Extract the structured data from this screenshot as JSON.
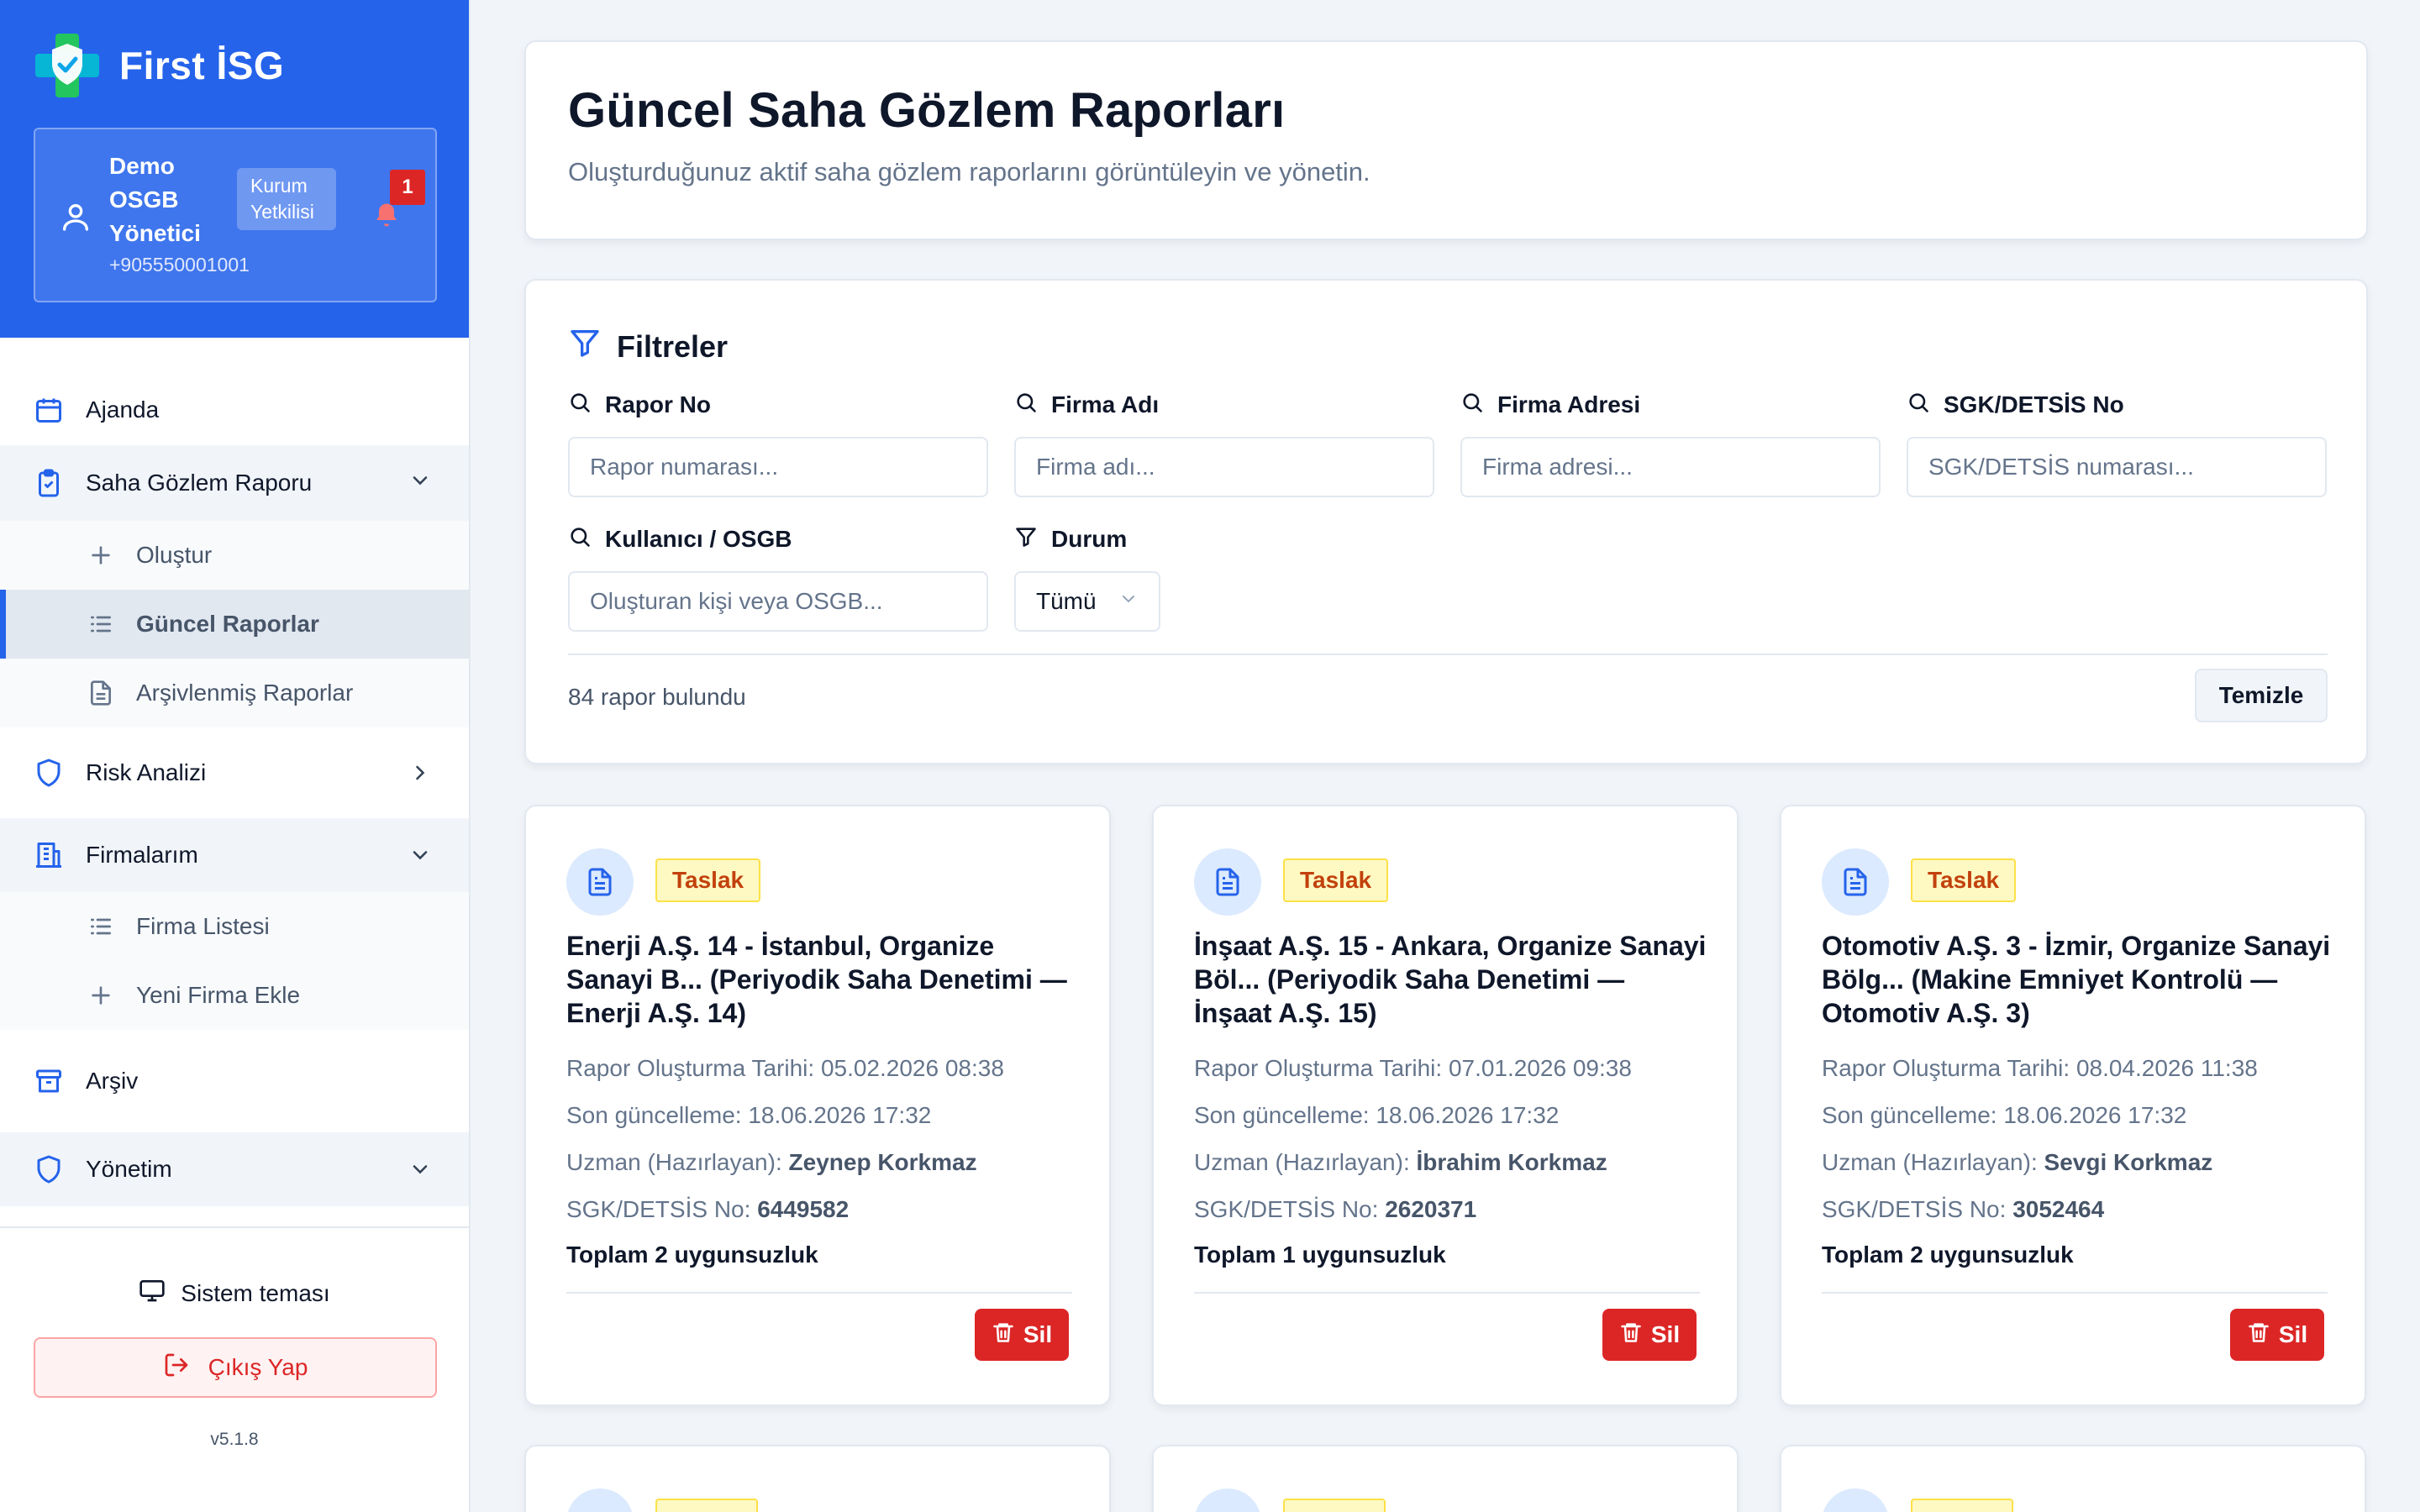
{
  "brand": {
    "name": "First İSG"
  },
  "user": {
    "name": "Demo OSGB Yönetici",
    "phone": "+905550001001",
    "role_line1": "Kurum",
    "role_line2": "Yetkilisi",
    "notifications": "1"
  },
  "nav": {
    "ajanda": "Ajanda",
    "saha": "Saha Gözlem Raporu",
    "saha_sub": [
      "Oluştur",
      "Güncel Raporlar",
      "Arşivlenmiş Raporlar"
    ],
    "risk": "Risk Analizi",
    "firmalarim": "Firmalarım",
    "firma_sub": [
      "Firma Listesi",
      "Yeni Firma Ekle"
    ],
    "arsiv": "Arşiv",
    "yonetim": "Yönetim"
  },
  "sidebar_bottom": {
    "theme": "Sistem teması",
    "logout": "Çıkış Yap",
    "version": "v5.1.8"
  },
  "header": {
    "title": "Güncel Saha Gözlem Raporları",
    "subtitle": "Oluşturduğunuz aktif saha gözlem raporlarını görüntüleyin ve yönetin."
  },
  "filters": {
    "title": "Filtreler",
    "rapor_no": {
      "label": "Rapor No",
      "placeholder": "Rapor numarası..."
    },
    "firma_adi": {
      "label": "Firma Adı",
      "placeholder": "Firma adı..."
    },
    "firma_adresi": {
      "label": "Firma Adresi",
      "placeholder": "Firma adresi..."
    },
    "sgk": {
      "label": "SGK/DETSİS No",
      "placeholder": "SGK/DETSİS numarası..."
    },
    "kullanici": {
      "label": "Kullanıcı / OSGB",
      "placeholder": "Oluşturan kişi veya OSGB..."
    },
    "durum": {
      "label": "Durum",
      "value": "Tümü"
    },
    "count": "84 rapor bulundu",
    "clear": "Temizle"
  },
  "reports": [
    {
      "status": "Taslak",
      "title": "Enerji A.Ş. 14 - İstanbul, Organize Sanayi B... (Periyodik Saha Denetimi — Enerji A.Ş. 14)",
      "created_label": "Rapor Oluşturma Tarihi:",
      "created": "05.02.2026 08:38",
      "updated_label": "Son güncelleme:",
      "updated": "18.06.2026 17:32",
      "expert_label": "Uzman (Hazırlayan):",
      "expert": "Zeynep Korkmaz",
      "sgk_label": "SGK/DETSİS No:",
      "sgk": "6449582",
      "total": "Toplam 2 uygunsuzluk",
      "delete": "Sil"
    },
    {
      "status": "Taslak",
      "title": "İnşaat A.Ş. 15 - Ankara, Organize Sanayi Böl... (Periyodik Saha Denetimi — İnşaat A.Ş. 15)",
      "created_label": "Rapor Oluşturma Tarihi:",
      "created": "07.01.2026 09:38",
      "updated_label": "Son güncelleme:",
      "updated": "18.06.2026 17:32",
      "expert_label": "Uzman (Hazırlayan):",
      "expert": "İbrahim Korkmaz",
      "sgk_label": "SGK/DETSİS No:",
      "sgk": "2620371",
      "total": "Toplam 1 uygunsuzluk",
      "delete": "Sil"
    },
    {
      "status": "Taslak",
      "title": "Otomotiv A.Ş. 3 - İzmir, Organize Sanayi Bölg... (Makine Emniyet Kontrolü — Otomotiv A.Ş. 3)",
      "created_label": "Rapor Oluşturma Tarihi:",
      "created": "08.04.2026 11:38",
      "updated_label": "Son güncelleme:",
      "updated": "18.06.2026 17:32",
      "expert_label": "Uzman (Hazırlayan):",
      "expert": "Sevgi Korkmaz",
      "sgk_label": "SGK/DETSİS No:",
      "sgk": "3052464",
      "total": "Toplam 2 uygunsuzluk",
      "delete": "Sil"
    }
  ],
  "colors": {
    "primary": "#2563eb",
    "danger": "#dc2626",
    "draft_bg": "#fef9c3",
    "draft_text": "#c2410c"
  }
}
